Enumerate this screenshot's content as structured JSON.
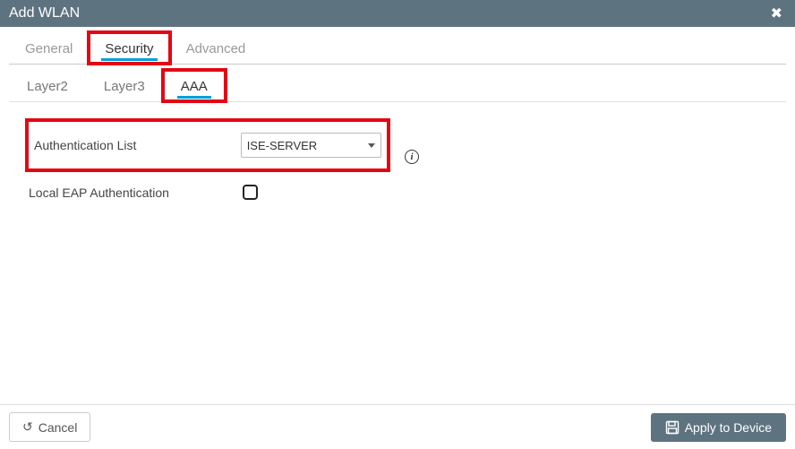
{
  "titlebar": {
    "title": "Add WLAN"
  },
  "tabs_primary": {
    "general": "General",
    "security": "Security",
    "advanced": "Advanced"
  },
  "tabs_secondary": {
    "layer2": "Layer2",
    "layer3": "Layer3",
    "aaa": "AAA"
  },
  "form": {
    "auth_list_label": "Authentication List",
    "auth_list_value": "ISE-SERVER",
    "local_eap_label": "Local EAP Authentication"
  },
  "footer": {
    "cancel_label": "Cancel",
    "apply_label": "Apply to Device"
  }
}
